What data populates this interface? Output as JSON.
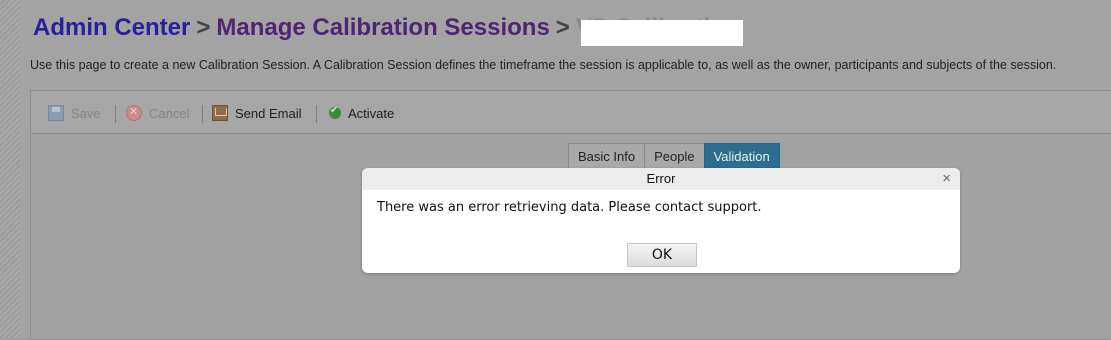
{
  "breadcrumb": {
    "root": "Admin Center",
    "separator": ">",
    "middle": "Manage Calibration Sessions",
    "current_partial": "VP Calibration"
  },
  "description": "Use this page to create a new Calibration Session. A Calibration Session defines the timeframe the session is applicable to, as well as the owner, participants and subjects of the session.",
  "toolbar": {
    "save_label": "Save",
    "cancel_label": "Cancel",
    "send_email_label": "Send Email",
    "activate_label": "Activate"
  },
  "tabs": [
    "Basic Info",
    "People",
    "Validation"
  ],
  "active_tab": "Validation",
  "dialog": {
    "title": "Error",
    "close_glyph": "×",
    "message": "There was an error retrieving data. Please contact support.",
    "ok_label": "OK"
  },
  "colors": {
    "breadcrumb_link": "#27209e",
    "breadcrumb_mid": "#4f2472",
    "active_tab": "#2d6e8e",
    "overlay": "#9e9e9e"
  }
}
